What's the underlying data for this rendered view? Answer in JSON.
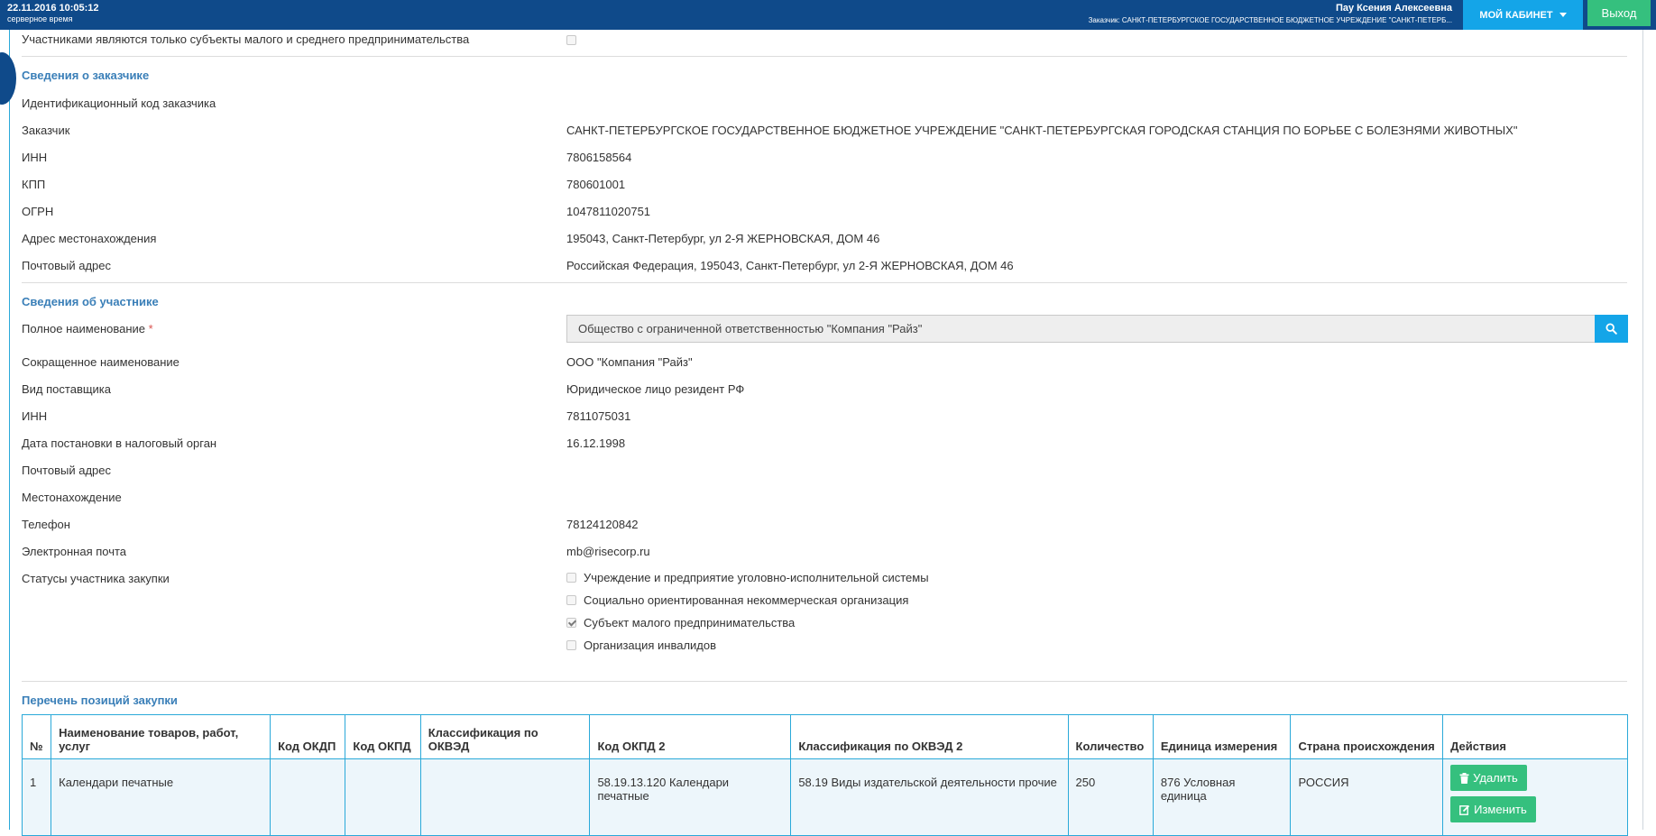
{
  "header": {
    "datetime": "22.11.2016 10:05:12",
    "time_note": "серверное время",
    "user_name": "Пау Ксения Алексеевна",
    "customer_line": "Заказчик: САНКТ-ПЕТЕРБУРГСКОЕ ГОСУДАРСТВЕННОЕ БЮДЖЕТНОЕ УЧРЕЖДЕНИЕ \"САНКТ-ПЕТЕРБ...",
    "cabinet_label": "МОЙ КАБИНЕТ",
    "exit_label": "Выход"
  },
  "sme_only": {
    "label": "Участниками являются только субъекты малого и среднего предпринимательства",
    "checked": false
  },
  "customer": {
    "title": "Сведения о заказчике",
    "rows": [
      {
        "label": "Идентификационный код заказчика",
        "value": ""
      },
      {
        "label": "Заказчик",
        "value": "САНКТ-ПЕТЕРБУРГСКОЕ ГОСУДАРСТВЕННОЕ БЮДЖЕТНОЕ УЧРЕЖДЕНИЕ \"САНКТ-ПЕТЕРБУРГСКАЯ ГОРОДСКАЯ СТАНЦИЯ ПО БОРЬБЕ С БОЛЕЗНЯМИ ЖИВОТНЫХ\""
      },
      {
        "label": "ИНН",
        "value": "7806158564"
      },
      {
        "label": "КПП",
        "value": "780601001"
      },
      {
        "label": "ОГРН",
        "value": "1047811020751"
      },
      {
        "label": "Адрес местонахождения",
        "value": "195043, Санкт-Петербург, ул 2-Я ЖЕРНОВСКАЯ, ДОМ 46"
      },
      {
        "label": "Почтовый адрес",
        "value": "Российская Федерация, 195043, Санкт-Петербург, ул 2-Я ЖЕРНОВСКАЯ, ДОМ 46"
      }
    ]
  },
  "participant": {
    "title": "Сведения об участнике",
    "full_name_label": "Полное наименование",
    "required_mark": "*",
    "full_name_value": "Общество с ограниченной ответственностью \"Компания \"Райз\"",
    "rows": [
      {
        "label": "Сокращенное наименование",
        "value": "ООО \"Компания \"Райз\""
      },
      {
        "label": "Вид поставщика",
        "value": "Юридическое лицо резидент РФ"
      },
      {
        "label": "ИНН",
        "value": "7811075031"
      },
      {
        "label": "Дата постановки в налоговый орган",
        "value": "16.12.1998"
      },
      {
        "label": "Почтовый адрес",
        "value": ""
      },
      {
        "label": "Местонахождение",
        "value": ""
      },
      {
        "label": "Телефон",
        "value": "78124120842"
      },
      {
        "label": "Электронная почта",
        "value": "mb@risecorp.ru"
      }
    ],
    "statuses_label": "Статусы участника закупки",
    "statuses": [
      {
        "label": "Учреждение и предприятие уголовно-исполнительной системы",
        "checked": false
      },
      {
        "label": "Социально ориентированная некоммерческая организация",
        "checked": false
      },
      {
        "label": "Субъект малого предпринимательства",
        "checked": true
      },
      {
        "label": "Организация инвалидов",
        "checked": false
      }
    ]
  },
  "positions": {
    "title": "Перечень позиций закупки",
    "columns": [
      "№",
      "Наименование товаров, работ, услуг",
      "Код ОКДП",
      "Код ОКПД",
      "Классификация по ОКВЭД",
      "Код ОКПД 2",
      "Классификация по ОКВЭД 2",
      "Количество",
      "Единица измерения",
      "Страна происхождения",
      "Действия"
    ],
    "rows": [
      {
        "num": "1",
        "name": "Календари печатные",
        "okdp": "",
        "okpd": "",
        "okved": "",
        "okpd2": "58.19.13.120 Календари печатные",
        "okved2": "58.19 Виды издательской деятельности прочие",
        "qty": "250",
        "unit": "876 Условная единица",
        "country": "РОССИЯ",
        "delete_label": "Удалить",
        "edit_label": "Изменить"
      }
    ]
  }
}
